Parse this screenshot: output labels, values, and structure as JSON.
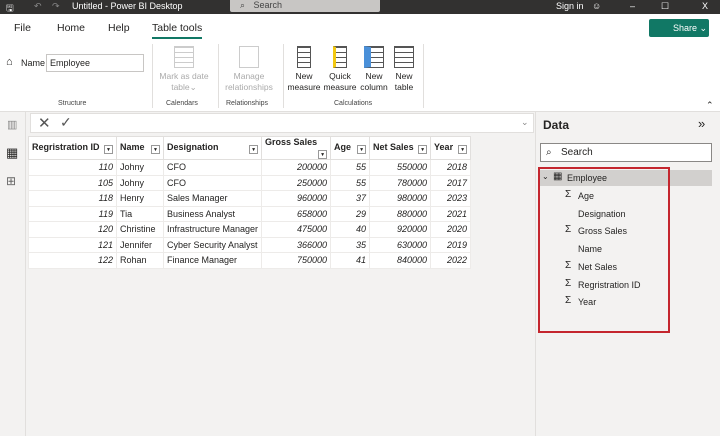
{
  "titlebar": {
    "title": "Untitled - Power BI Desktop",
    "search": "Search",
    "sign_in": "Sign in",
    "minimize": "–",
    "maximize": "☐",
    "close": "X"
  },
  "tabs": [
    "File",
    "Home",
    "Help",
    "Table tools"
  ],
  "share": "Share",
  "ribbon": {
    "name_label": "Name",
    "name_value": "Employee",
    "structure": "Structure",
    "mark_date": "Mark as date",
    "table_dd": "table",
    "calendars": "Calendars",
    "manage": "Manage",
    "relationships_btn": "relationships",
    "relationships": "Relationships",
    "new_measure": [
      "New",
      "measure"
    ],
    "quick_measure": [
      "Quick",
      "measure"
    ],
    "new_column": [
      "New",
      "column"
    ],
    "new_table": [
      "New",
      "table"
    ],
    "calculations": "Calculations"
  },
  "table": {
    "columns": [
      "Regristration ID",
      "Name",
      "Designation",
      "Gross Sales",
      "Age",
      "Net Sales",
      "Year"
    ],
    "rows": [
      [
        "110",
        "Johny",
        "CFO",
        "200000",
        "55",
        "550000",
        "2018"
      ],
      [
        "105",
        "Johny",
        "CFO",
        "250000",
        "55",
        "780000",
        "2017"
      ],
      [
        "118",
        "Henry",
        "Sales Manager",
        "960000",
        "37",
        "980000",
        "2023"
      ],
      [
        "119",
        "Tia",
        "Business Analyst",
        "658000",
        "29",
        "880000",
        "2021"
      ],
      [
        "120",
        "Christine",
        "Infrastructure Manager",
        "475000",
        "40",
        "920000",
        "2020"
      ],
      [
        "121",
        "Jennifer",
        "Cyber Security Analyst",
        "366000",
        "35",
        "630000",
        "2019"
      ],
      [
        "122",
        "Rohan",
        "Finance Manager",
        "750000",
        "41",
        "840000",
        "2022"
      ]
    ]
  },
  "data_pane": {
    "title": "Data",
    "search": "Search",
    "table": "Employee",
    "fields": [
      {
        "name": "Age",
        "sum": true
      },
      {
        "name": "Designation",
        "sum": false
      },
      {
        "name": "Gross Sales",
        "sum": true
      },
      {
        "name": "Name",
        "sum": false
      },
      {
        "name": "Net Sales",
        "sum": true
      },
      {
        "name": "Regristration ID",
        "sum": true
      },
      {
        "name": "Year",
        "sum": true
      }
    ]
  },
  "colors": {
    "accent": "#117865",
    "highlight": "#c4262e"
  }
}
